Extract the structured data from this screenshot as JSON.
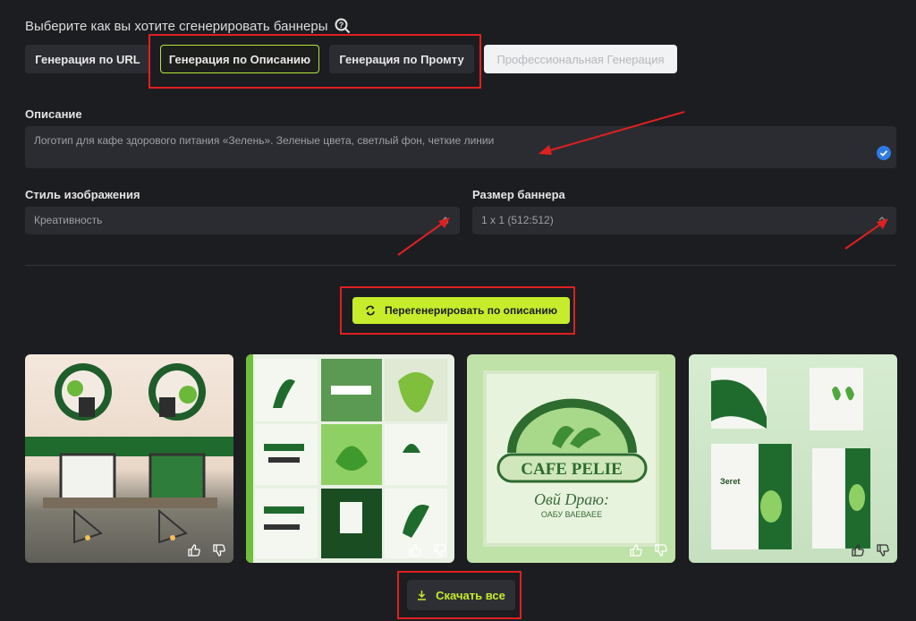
{
  "header": {
    "title": "Выберите как вы хотите сгенерировать баннеры"
  },
  "tabs": [
    {
      "label": "Генерация по URL"
    },
    {
      "label": "Генерация по Описанию",
      "active": true
    },
    {
      "label": "Генерация по Промту"
    },
    {
      "label": "Профессиональная Генерация",
      "disabled": true
    }
  ],
  "description": {
    "label": "Описание",
    "value": "Логотип для кафе здорового питания «Зелень». Зеленые цвета, светлый фон, четкие линии"
  },
  "style": {
    "label": "Стиль изображения",
    "value": "Креативность"
  },
  "size": {
    "label": "Размер баннера",
    "value": "1 x 1 (512:512)"
  },
  "regenerate_button": {
    "label": "Перегенерировать по описанию"
  },
  "download_button": {
    "label": "Скачать все"
  },
  "images": [
    {
      "id": 1
    },
    {
      "id": 2
    },
    {
      "id": 3,
      "logo_text": "CAFE PELIE",
      "logo_sub1": "Овй Dраю:",
      "logo_sub2": "ОАБУ ВАЕВАЕЕ"
    },
    {
      "id": 4,
      "logo_text": "Зегеt"
    }
  ],
  "colors": {
    "accent": "#c6ec2c",
    "annotation": "#e02020",
    "background": "#1c1d21"
  }
}
